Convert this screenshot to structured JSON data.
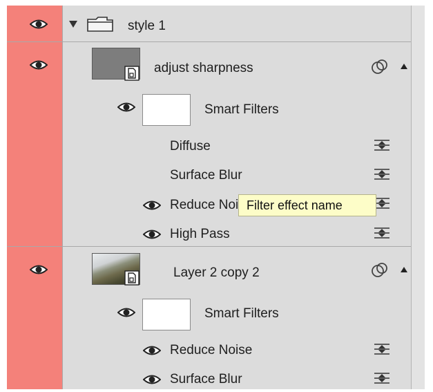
{
  "layers": {
    "group": {
      "name": "style 1"
    },
    "layer1": {
      "name": "adjust sharpness",
      "smart_filters_label": "Smart Filters",
      "filters": [
        "Diffuse",
        "Surface Blur",
        "Reduce Noise",
        "High Pass"
      ]
    },
    "layer2": {
      "name": "Layer 2 copy 2",
      "smart_filters_label": "Smart Filters",
      "filters": [
        "Reduce Noise",
        "Surface Blur"
      ]
    }
  },
  "tooltip": {
    "text": "Filter effect name"
  },
  "colors": {
    "visibility_column": "#f4817a",
    "panel": "#dcdcdc",
    "tooltip_bg": "#fdfdc8"
  },
  "icons": {
    "visibility": "eye-icon",
    "group": "folder-icon",
    "expand": "triangle-down-icon",
    "smart_object": "smart-object-badge-icon",
    "filter_options": "filter-blending-options-icon",
    "fx": "layer-effects-icon"
  }
}
